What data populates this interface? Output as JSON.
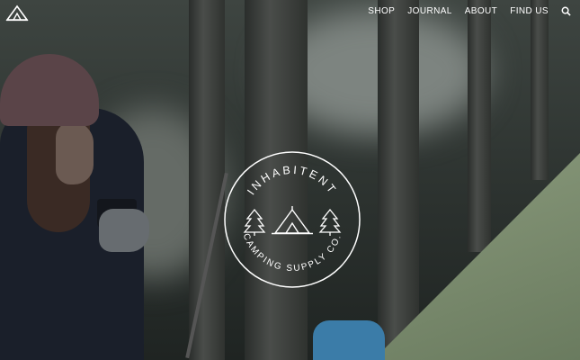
{
  "nav": {
    "items": [
      {
        "label": "SHOP"
      },
      {
        "label": "JOURNAL"
      },
      {
        "label": "ABOUT"
      },
      {
        "label": "FIND US"
      }
    ],
    "search_icon": "search-icon",
    "logo_icon": "tent-logo-icon"
  },
  "badge": {
    "top_text": "INHABITENT",
    "bottom_text": "CAMPING SUPPLY CO.",
    "icons": [
      "pine-tree-icon",
      "tent-icon",
      "pine-tree-icon"
    ]
  },
  "colors": {
    "text": "#ffffff",
    "overlay": "#2c322f",
    "tent": "#7d8c70"
  }
}
